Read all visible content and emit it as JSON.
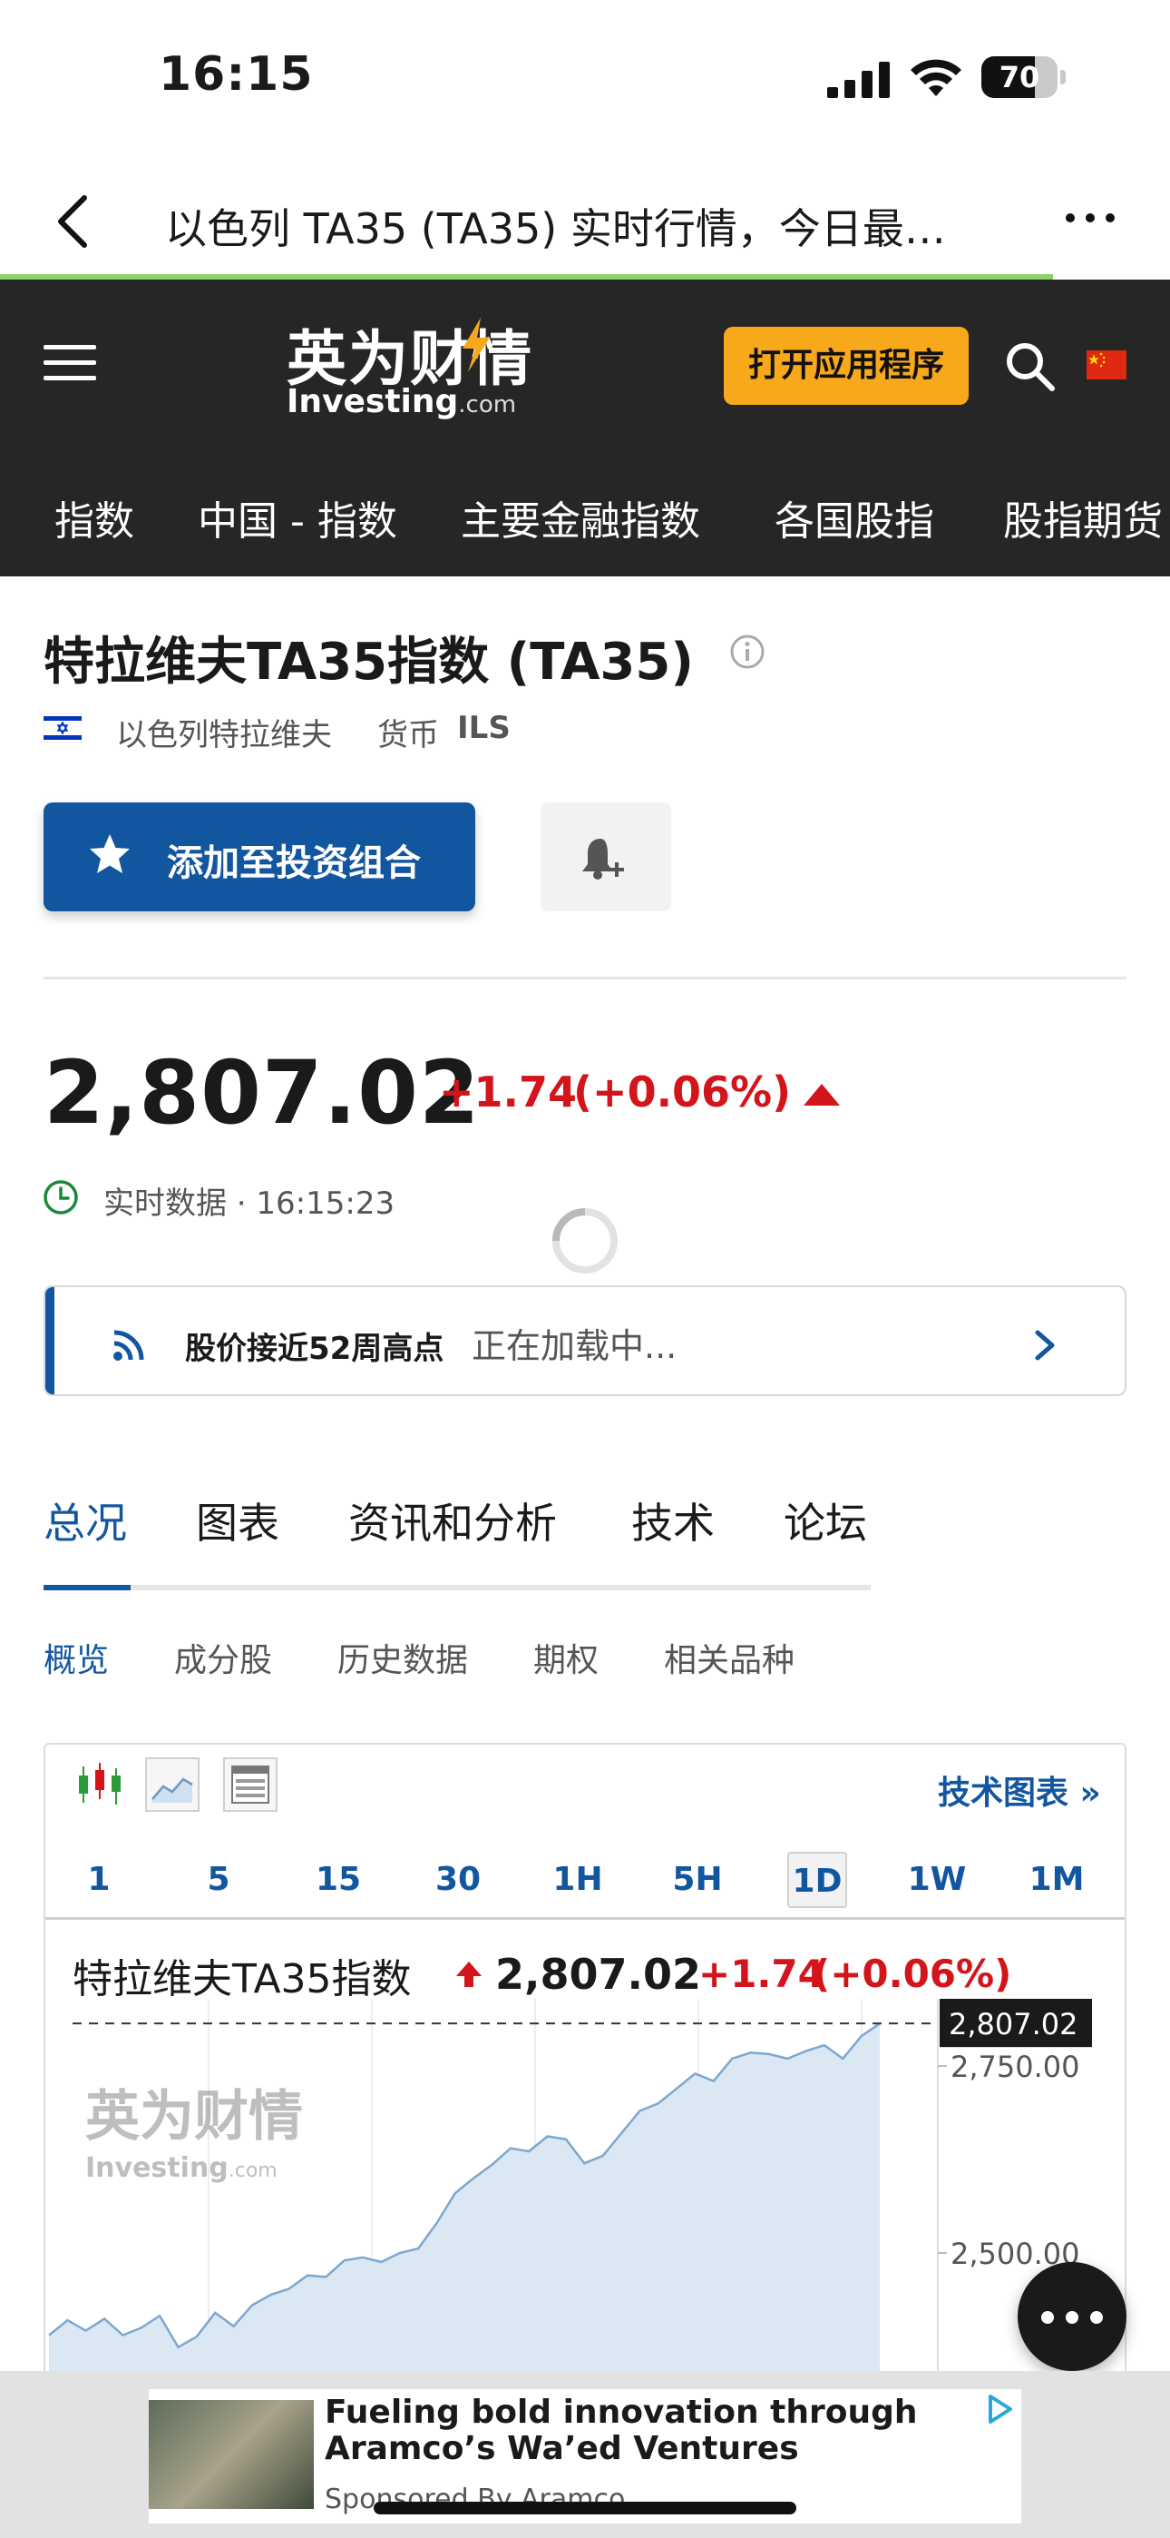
{
  "status_bar": {
    "time": "16:15",
    "battery": "70",
    "battery_level": 0.7
  },
  "browser": {
    "title": "以色列 TA35 (TA35) 实时行情，今日最…",
    "load_progress": 0.9
  },
  "site": {
    "logo_cn": "英为财情",
    "logo_en": "Investing",
    "logo_en_suffix": ".com",
    "open_app": "打开应用程序",
    "nav": [
      "指数",
      "中国 - 指数",
      "主要金融指数",
      "各国股指",
      "股指期货"
    ]
  },
  "instrument": {
    "title": "特拉维夫TA35指数 (TA35)",
    "exchange": "以色列特拉维夫",
    "currency_label": "货币",
    "currency": "ILS",
    "add_portfolio": "添加至投资组合",
    "price": "2,807.02",
    "change": "+1.74",
    "change_pct": "(+0.06%)",
    "realtime": "实时数据 · 16:15:23"
  },
  "news": {
    "label": "股价接近52周高点",
    "loading": "正在加载中..."
  },
  "tabs": [
    "总况",
    "图表",
    "资讯和分析",
    "技术",
    "论坛"
  ],
  "sub_tabs": [
    "概览",
    "成分股",
    "历史数据",
    "期权",
    "相关品种"
  ],
  "chart_widget": {
    "tech_chart_link": "技术图表 »",
    "timeframes": [
      "1",
      "5",
      "15",
      "30",
      "1H",
      "5H",
      "1D",
      "1W",
      "1M"
    ],
    "active_timeframe": "1D",
    "name": "特拉维夫TA35指数",
    "price": "2,807.02",
    "change": "+1.74",
    "change_pct": "(+0.06%)",
    "watermark_cn": "英为财情",
    "watermark_en": "Investing",
    "watermark_en_suffix": ".com"
  },
  "chart_data": {
    "type": "area",
    "y_ticks": [
      "2,750.00",
      "2,500.00"
    ],
    "last_price_label": "2,807.02",
    "ylim": [
      2330,
      2840
    ],
    "values": [
      2390,
      2410,
      2396,
      2412,
      2390,
      2400,
      2416,
      2374,
      2388,
      2420,
      2402,
      2430,
      2444,
      2452,
      2470,
      2468,
      2490,
      2494,
      2488,
      2500,
      2506,
      2540,
      2580,
      2600,
      2618,
      2640,
      2636,
      2656,
      2652,
      2620,
      2630,
      2660,
      2690,
      2700,
      2720,
      2740,
      2730,
      2760,
      2768,
      2766,
      2760,
      2770,
      2778,
      2760,
      2790,
      2807
    ],
    "grid": true,
    "dashed_line_at": 2807.02
  },
  "ad": {
    "headline": "Fueling bold innovation through Aramco’s Wa’ed Ventures",
    "sponsor": "Sponsored By Aramco"
  },
  "colors": {
    "accent": "#1256a0",
    "negative_red": "#d3141a",
    "header_bg": "#262626",
    "cta_orange": "#f7a81b",
    "chart_fill": "#dbe8f4",
    "chart_line": "#7da7cf"
  }
}
